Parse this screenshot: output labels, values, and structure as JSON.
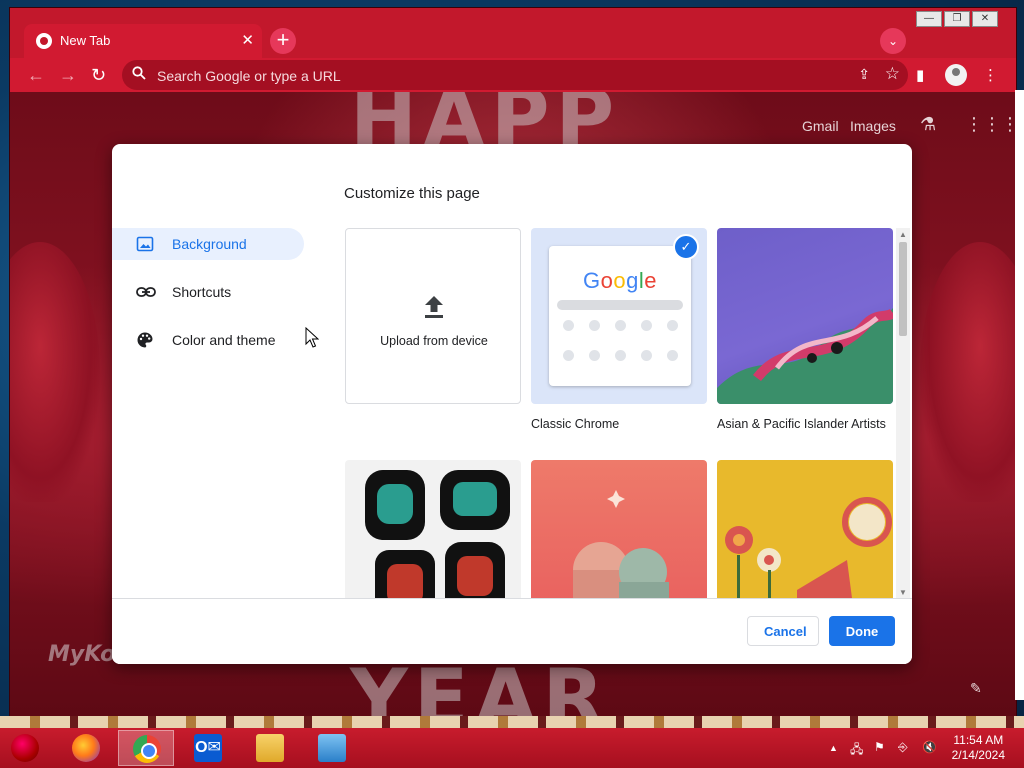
{
  "browser": {
    "tab_title": "New Tab",
    "omnibox_placeholder": "Search Google or type a URL"
  },
  "ntp": {
    "links": [
      "Gmail",
      "Images"
    ],
    "watermark": "MyKoolScreens.com"
  },
  "dialog": {
    "title": "Customize this page",
    "sidebar": [
      {
        "label": "Background",
        "icon": "image-icon",
        "active": true
      },
      {
        "label": "Shortcuts",
        "icon": "link-icon",
        "active": false
      },
      {
        "label": "Color and theme",
        "icon": "palette-icon",
        "active": false
      }
    ],
    "tiles": [
      {
        "caption": "Upload from device",
        "kind": "upload"
      },
      {
        "caption": "Classic Chrome",
        "kind": "classic",
        "selected": true
      },
      {
        "caption": "Asian & Pacific Islander Artists",
        "kind": "collection"
      },
      {
        "caption": "",
        "kind": "collection"
      },
      {
        "caption": "",
        "kind": "collection"
      },
      {
        "caption": "",
        "kind": "collection"
      }
    ],
    "google_logo": "Google",
    "cancel_label": "Cancel",
    "done_label": "Done"
  },
  "taskbar": {
    "apps": [
      "start-orb",
      "firefox-icon",
      "chrome-icon",
      "outlook-icon",
      "file-explorer-icon",
      "control-panel-icon"
    ],
    "active_app": "chrome-icon",
    "time": "11:54 AM",
    "date": "2/14/2024"
  },
  "colors": {
    "accent": "#1a73e8",
    "theme_red": "#c2182c"
  }
}
